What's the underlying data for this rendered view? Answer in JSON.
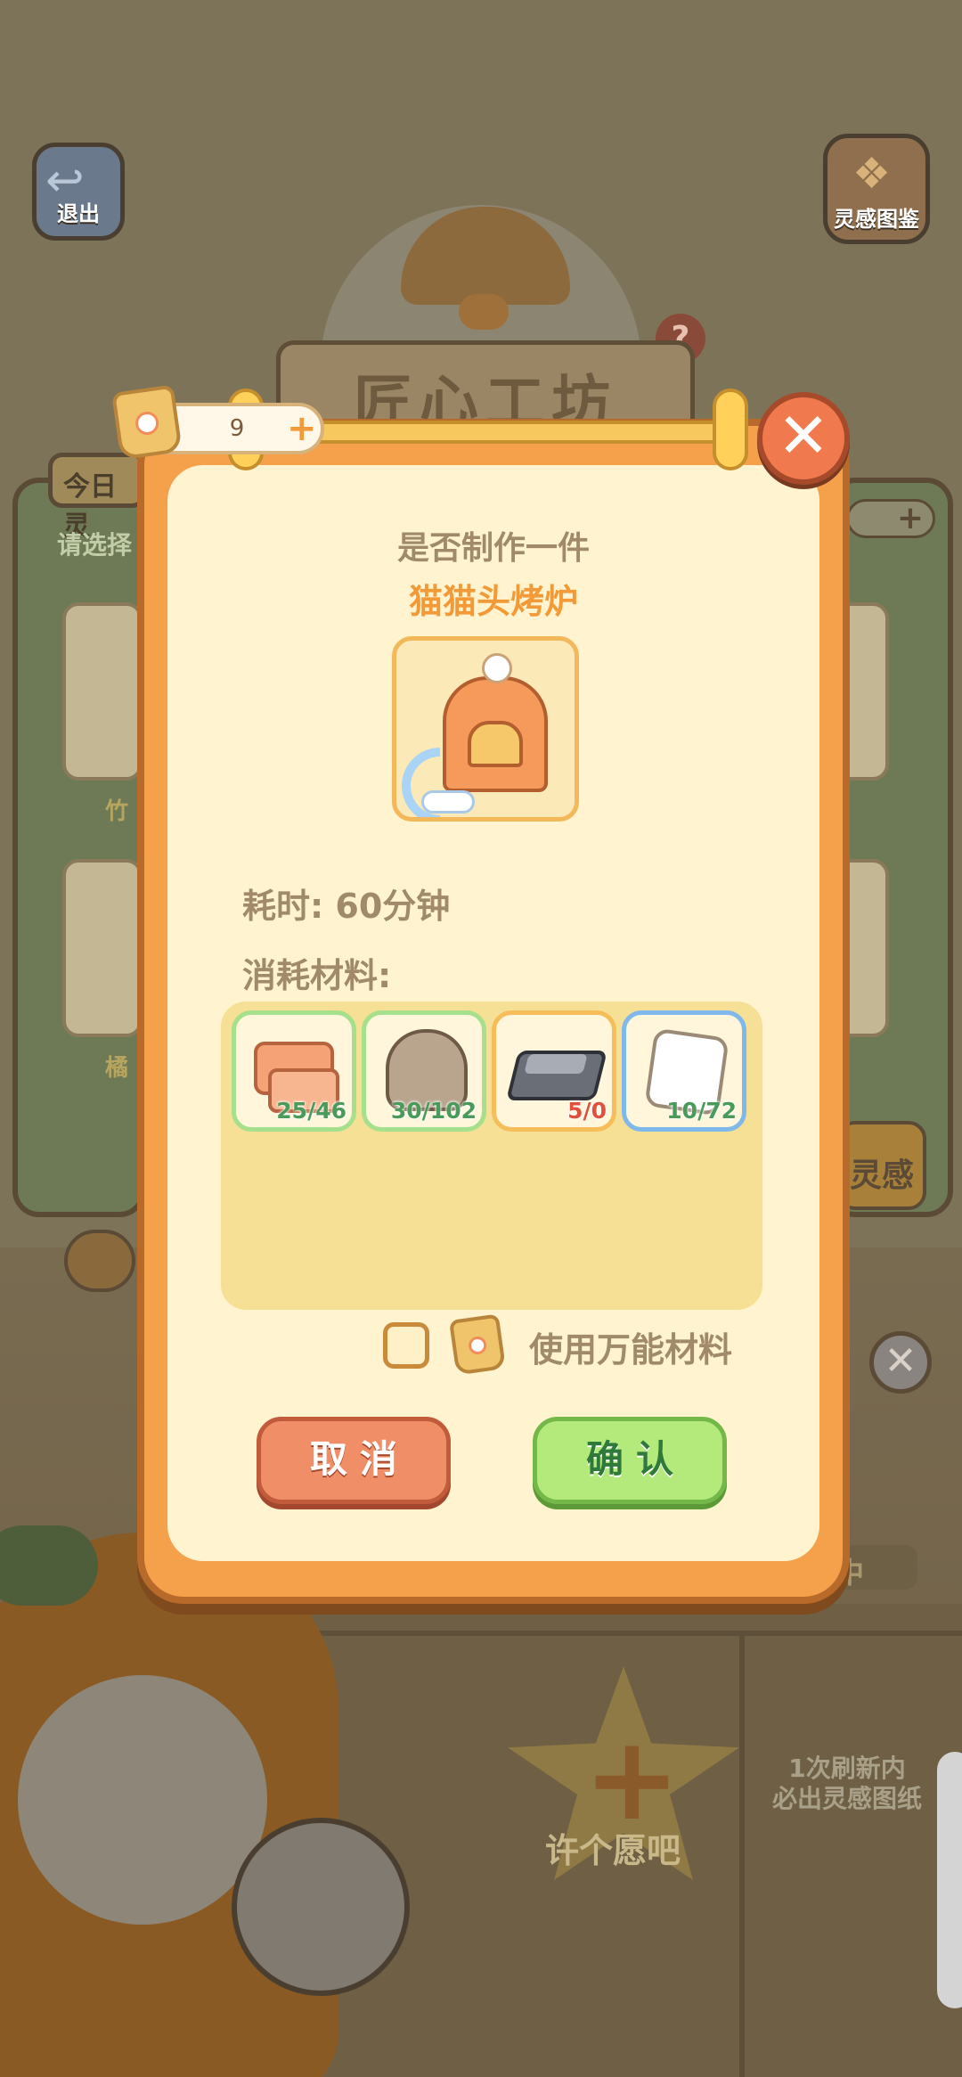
{
  "background": {
    "exit_label": "退出",
    "atlas_label": "灵感图鉴",
    "sign_title": "匠心工坊",
    "help_badge": "?",
    "left_tab": "今日灵",
    "left_hint": "请选择",
    "left_slot_labels": [
      "竹",
      "橘"
    ],
    "right_inspiration": "灵感",
    "right_status": "中",
    "right_close": "✕",
    "wish_plus": "+",
    "wish_label": "许个愿吧",
    "refresh_line1": "1次刷新内",
    "refresh_line2": "必出灵感图纸"
  },
  "header": {
    "currency_value": "9",
    "currency_plus": "+",
    "close_symbol": "✕"
  },
  "dialog": {
    "question": "是否制作一件",
    "item_name": "猫猫头烤炉",
    "time_text": "耗时: 60分钟",
    "materials_label": "消耗材料:",
    "materials": [
      {
        "name": "wood",
        "count": "25/46"
      },
      {
        "name": "stone",
        "count": "30/102"
      },
      {
        "name": "iron",
        "count": "5/0"
      },
      {
        "name": "cloth",
        "count": "10/72"
      }
    ],
    "universal_label": "使用万能材料",
    "universal_checked": false,
    "cancel_label": "取消",
    "confirm_label": "确认"
  },
  "colors": {
    "accent_orange": "#f29a38",
    "confirm_green": "#b4ea7c",
    "cancel_red": "#f08e68",
    "shortage_red": "#e0503a",
    "enough_green": "#4a9a5a"
  }
}
